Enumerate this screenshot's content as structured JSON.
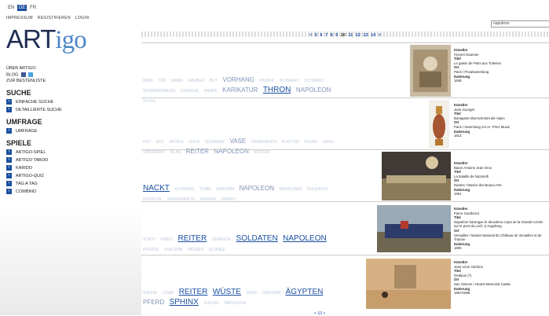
{
  "languages": [
    "EN",
    "DE",
    "FR"
  ],
  "active_language": "DE",
  "top_nav": [
    "IMPRESSUM",
    "REGISTRIEREN",
    "LOGIN"
  ],
  "logo": {
    "part1": "ART",
    "part2": "igo"
  },
  "sidebar_links": {
    "ueber": "ÜBER ARTIGO",
    "blog": "BLOG",
    "bestenliste": "ZUR BESTENLISTE"
  },
  "sections": {
    "suche": {
      "title": "SUCHE",
      "items": [
        "EINFACHE SUCHE",
        "DETAILLIERTE SUCHE"
      ]
    },
    "umfrage": {
      "title": "UMFRAGE",
      "items": [
        "UMFRAGE"
      ]
    },
    "spiele": {
      "title": "SPIELE",
      "items": [
        "ARTIGO-SPIEL",
        "ARTIGO TABOO",
        "KARIDO",
        "ARTIGO-QUIZ",
        "TAG A TAG",
        "COMBINO"
      ]
    }
  },
  "search": {
    "value": "napoleon"
  },
  "pagination": {
    "prev": "<",
    "pages": [
      "5",
      "6",
      "7",
      "8",
      "9",
      "10",
      "11",
      "12",
      "13",
      "14"
    ],
    "current": "10",
    "next": ">"
  },
  "results": [
    {
      "tags": [
        "WEIB",
        "TOD",
        "MANN",
        "RAUBER",
        "HUT",
        "VORHANG",
        "KINDER",
        "SCHWERT",
        "SCHWARZ",
        "SCHWARZWEISS",
        "STRASSE",
        "KAMPF",
        "KARIKATUR",
        "THRON",
        "NAPOLEON",
        "STUHL"
      ],
      "labels": {
        "kuenstler": "Künstler",
        "titel": "Titel",
        "ort": "Ort",
        "datierung": "Datierung"
      },
      "kuenstler": "Honoré Daumier",
      "titel": "Le gamin de Paris aux Tuileries",
      "ort": "Paris / Privatsammlung",
      "datierung": "1848"
    },
    {
      "tags": [
        "HUT",
        "ROT",
        "ANTIKE",
        "GOLD",
        "SCHWARZ",
        "VASE",
        "FRANKREICH",
        "PLATTER",
        "PFERD",
        "GRAU",
        "ORNAMENT",
        "BLAU",
        "REITER",
        "NAPOLEON",
        "KUSTEN"
      ],
      "labels": {
        "kuenstler": "Künstler",
        "titel": "Titel",
        "ort": "Ort",
        "datierung": "Datierung"
      },
      "kuenstler": "Jean Georget",
      "titel": "Bonaparte überschreitet die Alpen",
      "ort": "Paris / Sammlung S.K.H. Prinz Murat",
      "datierung": "1813"
    },
    {
      "tags": [
        "NACKT",
        "SCHWARZ",
        "TURM",
        "UNIFORM",
        "NAPOLEON",
        "MENSCHEN",
        "SOLDATEN",
        "HOSPITAL",
        "VERWUNDETE",
        "KRANKE",
        "ORIENT"
      ],
      "labels": {
        "kuenstler": "Künstler",
        "titel": "Titel",
        "ort": "Ort",
        "datierung": "Datierung"
      },
      "kuenstler": "Baron Antoine Jean Gros",
      "titel": "La bataille de Nazareth",
      "ort": "Nantes / Musée des Beaux-Arts",
      "datierung": "1801"
    },
    {
      "tags": [
        "STADT",
        "KRIEG",
        "REITER",
        "GEBÄUDE",
        "SOLDATEN",
        "NAPOLEON",
        "PFERDE",
        "UNIFORM",
        "HÄUSER",
        "SCHNEE"
      ],
      "labels": {
        "kuenstler": "Künstler",
        "titel": "Titel",
        "ort": "Ort",
        "datierung": "Datierung"
      },
      "kuenstler": "Pierre Gautherot",
      "titel": "Napoléon harangue le deuxième corps de la Grande Armée sur le pont du Lech, à Augsburg",
      "ort": "Versailles / Musée National du Château de Versailles et de Trianon",
      "datierung": "1805"
    },
    {
      "tags": [
        "STEINE",
        "LÖWE",
        "REITER",
        "WÜSTE",
        "SAND",
        "UNIFORM",
        "ÄGYPTEN",
        "PFERD",
        "SPHINX",
        "SOLDAT",
        "NAPOLEON"
      ],
      "labels": {
        "kuenstler": "Künstler",
        "titel": "Titel",
        "ort": "Ort",
        "datierung": "Datierung"
      },
      "kuenstler": "Jean-Léon Gérôme",
      "titel": "Oedipus (?)",
      "ort": "San Simeon / Hearst Memorial Castle",
      "datierung": "1867/1868"
    }
  ],
  "colors": {
    "accent": "#1b4fa0",
    "logo_dark": "#1f2d52",
    "logo_light": "#4c86c8"
  }
}
